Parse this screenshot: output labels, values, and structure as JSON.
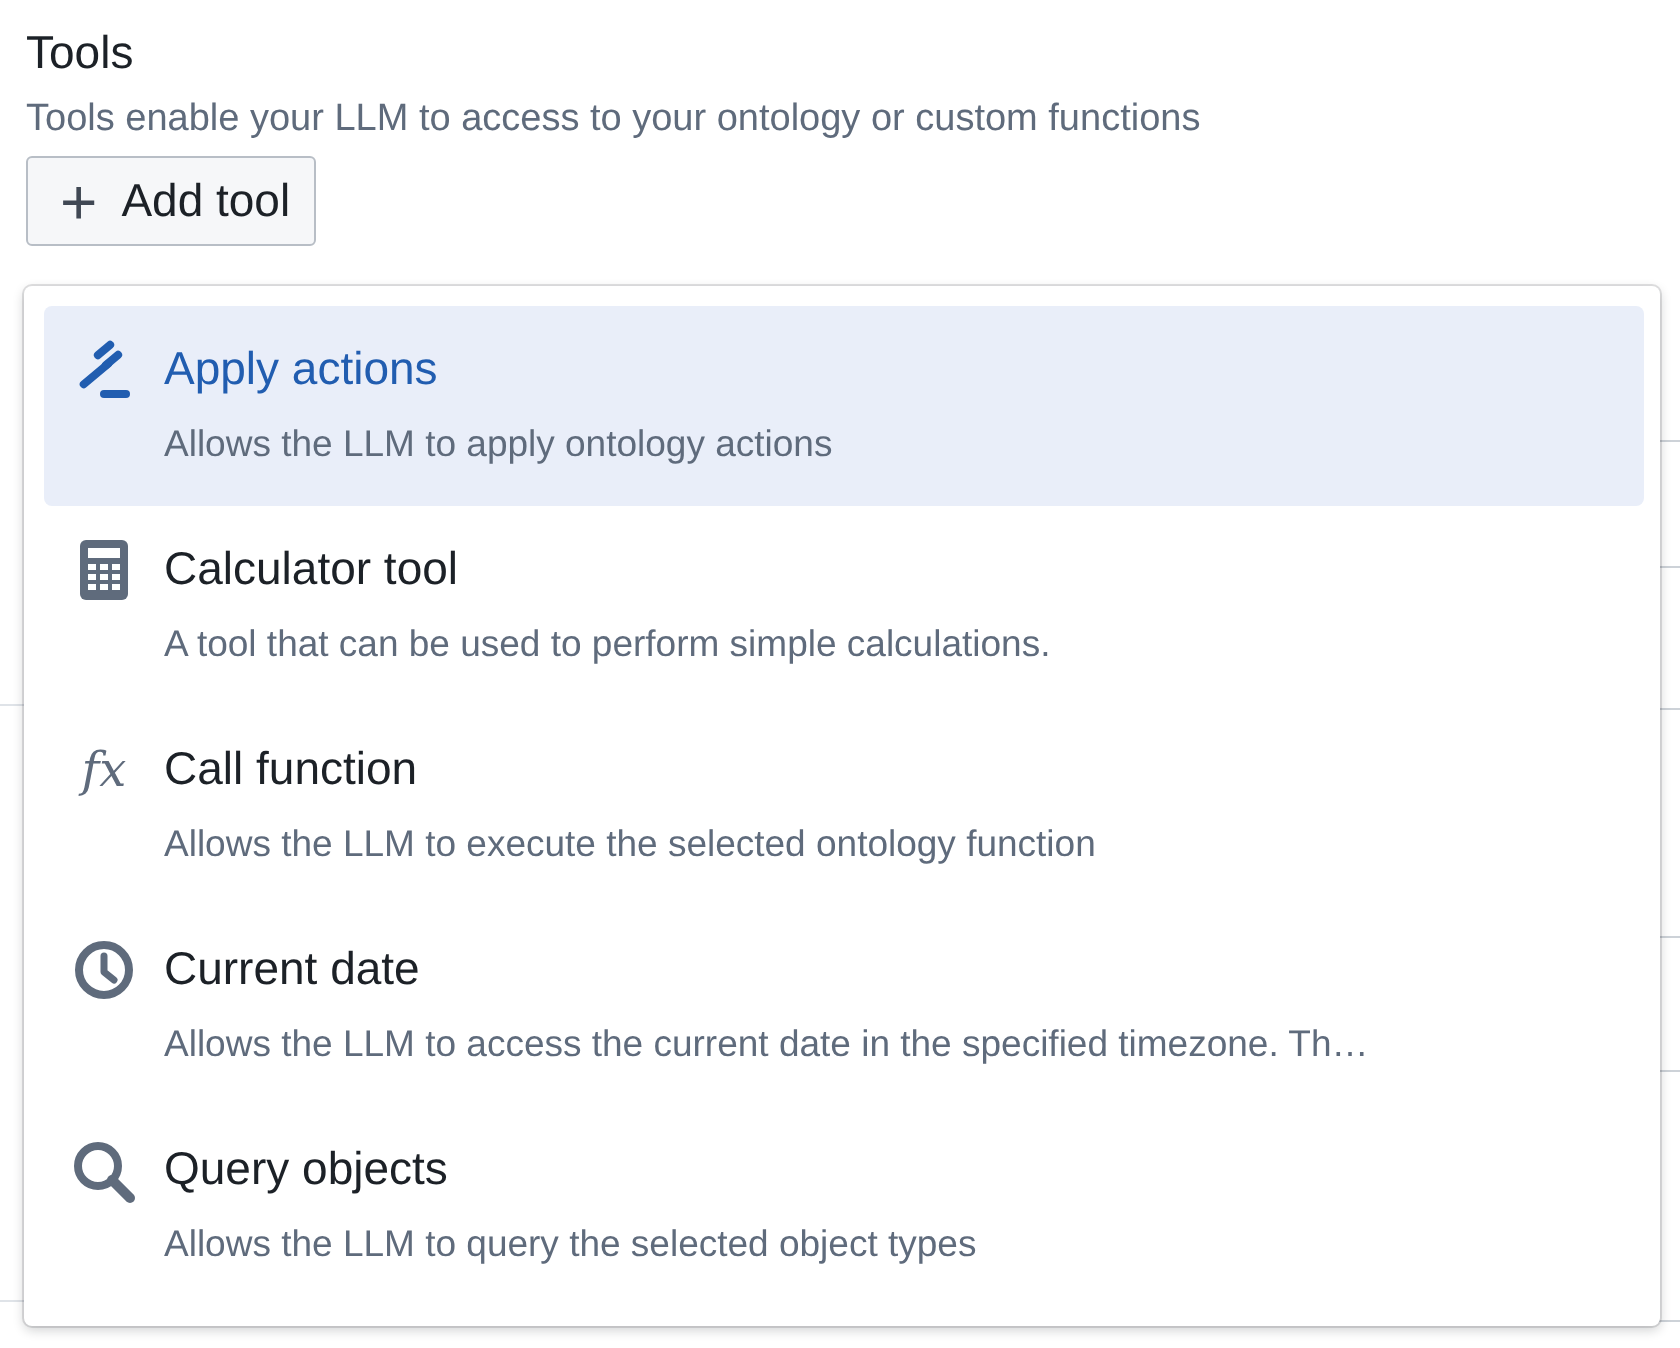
{
  "section": {
    "title": "Tools",
    "description": "Tools enable your LLM to access to your ontology or custom functions"
  },
  "add_button": {
    "label": "Add tool",
    "icon": "+"
  },
  "menu": {
    "items": [
      {
        "kind": "actions",
        "title": "Apply actions",
        "description": "Allows the LLM to apply ontology actions",
        "selected": true
      },
      {
        "kind": "calculator",
        "title": "Calculator tool",
        "description": "A tool that can be used to perform simple calculations.",
        "selected": false
      },
      {
        "kind": "function",
        "icon_text": "fx",
        "title": "Call function",
        "description": "Allows the LLM to execute the selected ontology function",
        "selected": false
      },
      {
        "kind": "clock",
        "title": "Current date",
        "description": "Allows the LLM to access the current date in the specified timezone. Th…",
        "selected": false
      },
      {
        "kind": "search",
        "title": "Query objects",
        "description": "Allows the LLM to query the selected object types",
        "selected": false
      }
    ]
  }
}
